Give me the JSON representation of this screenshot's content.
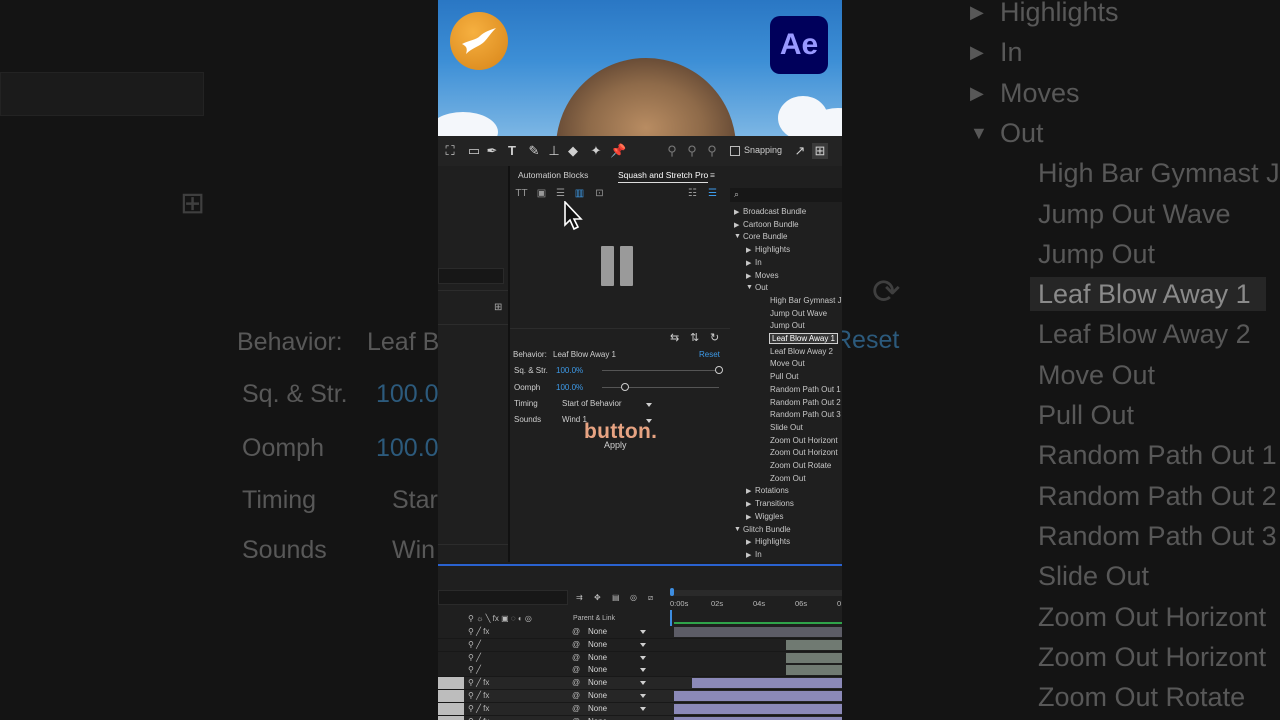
{
  "background_left": {
    "behavior_label": "Behavior:",
    "behavior_value": "Leaf B",
    "sq_label": "Sq. & Str.",
    "sq_value": "100.0",
    "oomph_label": "Oomph",
    "oomph_value": "100.0",
    "timing_label": "Timing",
    "timing_value": "Star",
    "sounds_label": "Sounds",
    "sounds_value": "Win"
  },
  "background_right": {
    "items": [
      "Highlights",
      "In",
      "Moves",
      "Out",
      "High Bar Gymnast J",
      "Jump Out Wave",
      "Jump Out",
      "Leaf Blow Away 1",
      "Leaf Blow Away 2",
      "Move Out",
      "Pull Out",
      "Random Path Out 1",
      "Random Path Out 2",
      "Random Path Out 3",
      "Slide Out",
      "Zoom Out Horizont",
      "Zoom Out Horizont",
      "Zoom Out Rotate"
    ],
    "reset_fragment": "Reset"
  },
  "hero": {
    "app_badge": "Ae"
  },
  "toolbar": {
    "snapping_label": "Snapping"
  },
  "panel": {
    "tabs": [
      "Automation Blocks",
      "Squash and Stretch Pro"
    ],
    "behavior_label": "Behavior:",
    "behavior_value": "Leaf Blow Away 1",
    "reset_label": "Reset",
    "sq_label": "Sq. & Str.",
    "sq_value": "100.0%",
    "sq_level": 1.0,
    "oomph_label": "Oomph",
    "oomph_value": "100.0%",
    "oomph_level": 0.2,
    "timing_label": "Timing",
    "timing_value": "Start of Behavior",
    "sounds_label": "Sounds",
    "sounds_value": "Wind 1",
    "caption": "button.",
    "apply_label": "Apply"
  },
  "tree": {
    "items": [
      {
        "label": "Broadcast Bundle",
        "arrow": "▶",
        "depth": 0
      },
      {
        "label": "Cartoon Bundle",
        "arrow": "▶",
        "depth": 0
      },
      {
        "label": "Core Bundle",
        "arrow": "▼",
        "depth": 0
      },
      {
        "label": "Highlights",
        "arrow": "▶",
        "depth": 1
      },
      {
        "label": "In",
        "arrow": "▶",
        "depth": 1
      },
      {
        "label": "Moves",
        "arrow": "▶",
        "depth": 1
      },
      {
        "label": "Out",
        "arrow": "▼",
        "depth": 1
      },
      {
        "label": "High Bar Gymnast J",
        "arrow": "",
        "depth": 2
      },
      {
        "label": "Jump Out Wave",
        "arrow": "",
        "depth": 2
      },
      {
        "label": "Jump Out",
        "arrow": "",
        "depth": 2
      },
      {
        "label": "Leaf Blow Away 1",
        "arrow": "",
        "depth": 2,
        "selected": true
      },
      {
        "label": "Leaf Blow Away 2",
        "arrow": "",
        "depth": 2
      },
      {
        "label": "Move Out",
        "arrow": "",
        "depth": 2
      },
      {
        "label": "Pull Out",
        "arrow": "",
        "depth": 2
      },
      {
        "label": "Random Path Out 1",
        "arrow": "",
        "depth": 2
      },
      {
        "label": "Random Path Out 2",
        "arrow": "",
        "depth": 2
      },
      {
        "label": "Random Path Out 3",
        "arrow": "",
        "depth": 2
      },
      {
        "label": "Slide Out",
        "arrow": "",
        "depth": 2
      },
      {
        "label": "Zoom Out Horizont",
        "arrow": "",
        "depth": 2
      },
      {
        "label": "Zoom Out Horizont",
        "arrow": "",
        "depth": 2
      },
      {
        "label": "Zoom Out Rotate",
        "arrow": "",
        "depth": 2
      },
      {
        "label": "Zoom Out",
        "arrow": "",
        "depth": 2
      },
      {
        "label": "Rotations",
        "arrow": "▶",
        "depth": 1
      },
      {
        "label": "Transitions",
        "arrow": "▶",
        "depth": 1
      },
      {
        "label": "Wiggles",
        "arrow": "▶",
        "depth": 1
      },
      {
        "label": "Glitch Bundle",
        "arrow": "▼",
        "depth": 0
      },
      {
        "label": "Highlights",
        "arrow": "▶",
        "depth": 1
      },
      {
        "label": "In",
        "arrow": "▶",
        "depth": 1
      }
    ]
  },
  "timeline": {
    "parent_link_header": "Parent & Link",
    "timecodes": [
      "0:00s",
      "02s",
      "04s",
      "06s",
      "0"
    ],
    "parent_values": [
      "None",
      "None",
      "None",
      "None",
      "None",
      "None",
      "None",
      "None"
    ]
  },
  "colors": {
    "accent_blue": "#3d9ae8",
    "timeline_green": "#2fa34a",
    "caption": "#e7a382"
  }
}
